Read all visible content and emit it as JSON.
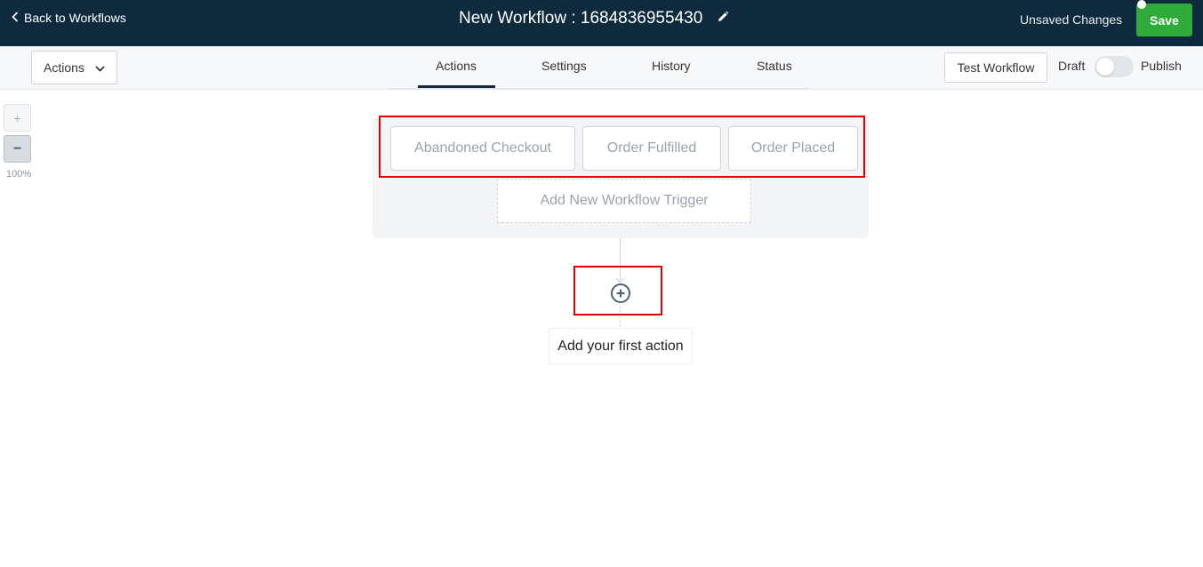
{
  "header": {
    "back_label": "Back to Workflows",
    "title": "New Workflow : 1684836955430",
    "unsaved_label": "Unsaved Changes",
    "save_label": "Save"
  },
  "toolbar": {
    "actions_dropdown_label": "Actions",
    "tabs": [
      {
        "label": "Actions",
        "active": true
      },
      {
        "label": "Settings",
        "active": false
      },
      {
        "label": "History",
        "active": false
      },
      {
        "label": "Status",
        "active": false
      }
    ],
    "test_label": "Test Workflow",
    "draft_label": "Draft",
    "publish_label": "Publish",
    "publish_toggle_on": false
  },
  "zoom": {
    "in_label": "+",
    "out_label": "−",
    "level": "100%"
  },
  "canvas": {
    "triggers": [
      "Abandoned Checkout",
      "Order Fulfilled",
      "Order Placed"
    ],
    "add_trigger_label": "Add New Workflow Trigger",
    "first_action_label": "Add your first action"
  },
  "colors": {
    "header_bg": "#0f2a3d",
    "save_green": "#2eab3a",
    "highlight_red": "#e10000"
  },
  "icons": [
    "chevron-left-icon",
    "pencil-icon",
    "chevron-down-icon",
    "plus-circle-icon"
  ]
}
